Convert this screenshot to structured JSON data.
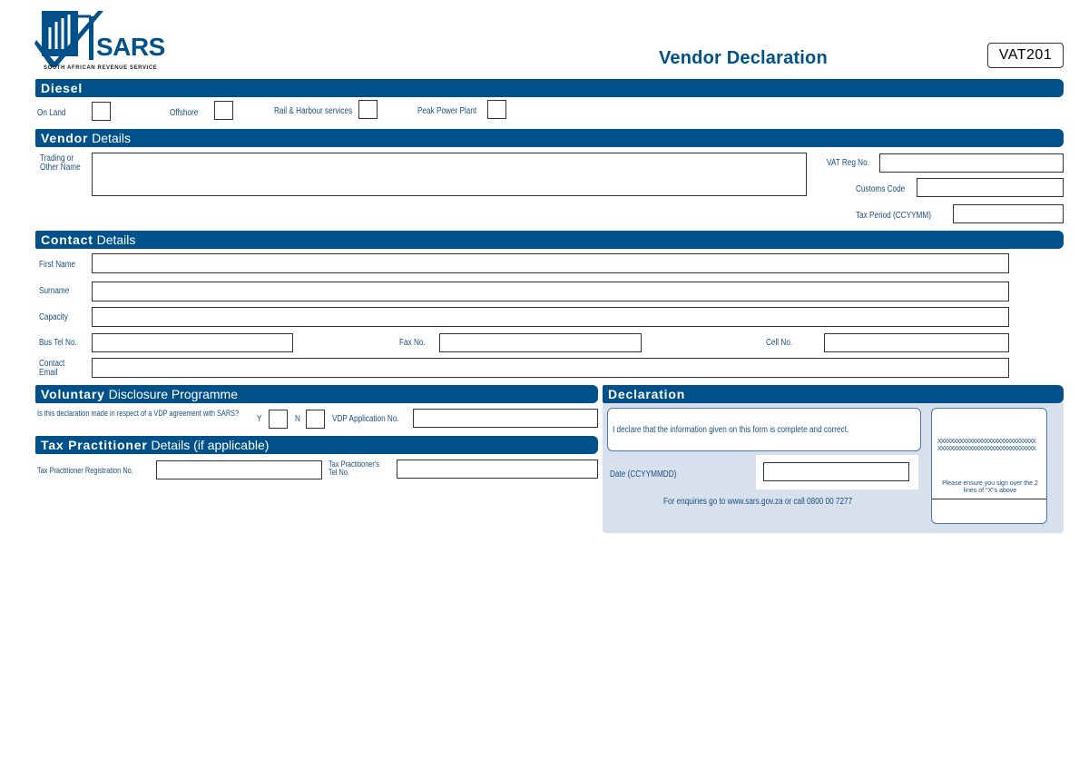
{
  "header": {
    "logo_name": "SARS",
    "logo_subtitle": "SOUTH AFRICAN REVENUE SERVICE",
    "title": "Vendor Declaration",
    "form_code": "VAT201"
  },
  "colors": {
    "brand_blue": "#005189",
    "panel_bg": "#d7e0ec"
  },
  "diesel": {
    "heading": "Diesel",
    "options": [
      {
        "label": "On Land",
        "checked": false
      },
      {
        "label": "Offshore",
        "checked": false
      },
      {
        "label": "Rail & Harbour services",
        "checked": false
      },
      {
        "label": "Peak Power Plant",
        "checked": false
      }
    ]
  },
  "vendor": {
    "heading_bold": "Vendor",
    "heading_light": "Details",
    "trading_name_label": "Trading or Other Name",
    "trading_name_value": "",
    "vat_reg_label": "VAT Reg No.",
    "vat_reg_value": "",
    "customs_code_label": "Customs Code",
    "customs_code_value": "",
    "tax_period_label": "Tax Period (CCYYMM)",
    "tax_period_value": ""
  },
  "contact": {
    "heading_bold": "Contact",
    "heading_light": "Details",
    "first_name_label": "First Name",
    "surname_label": "Surname",
    "capacity_label": "Capacity",
    "bus_tel_label": "Bus Tel No.",
    "fax_label": "Fax No.",
    "cell_label": "Cell No.",
    "email_label": "Contact Email"
  },
  "vdp": {
    "heading_bold": "Voluntary",
    "heading_light": "Disclosure Programme",
    "question": "Is this declaration made in respect of a VDP agreement with SARS?",
    "yes_label": "Y",
    "no_label": "N",
    "app_no_label": "VDP Application No."
  },
  "tax_practitioner": {
    "heading_bold": "Tax Practitioner",
    "heading_light": "Details (if applicable)",
    "reg_no_label": "Tax Practitioner Registration No.",
    "tel_label": "Tax Practitioner's Tel No."
  },
  "declaration": {
    "heading": "Declaration",
    "statement": "I declare that the information given on this form is complete and correct.",
    "date_label": "Date (CCYYMMDD)",
    "enquiries": "For enquiries go to www.sars.gov.za or call 0800 00 7277",
    "signature_line1": "XXXXXXXXXXXXXXXXXXXXXXXXXXXXXXX",
    "signature_line2": "XXXXXXXXXXXXXXXXXXXXXXXXXXXXXXX",
    "signature_note": "Please ensure you sign over the 2 lines of \"X\"s above"
  }
}
